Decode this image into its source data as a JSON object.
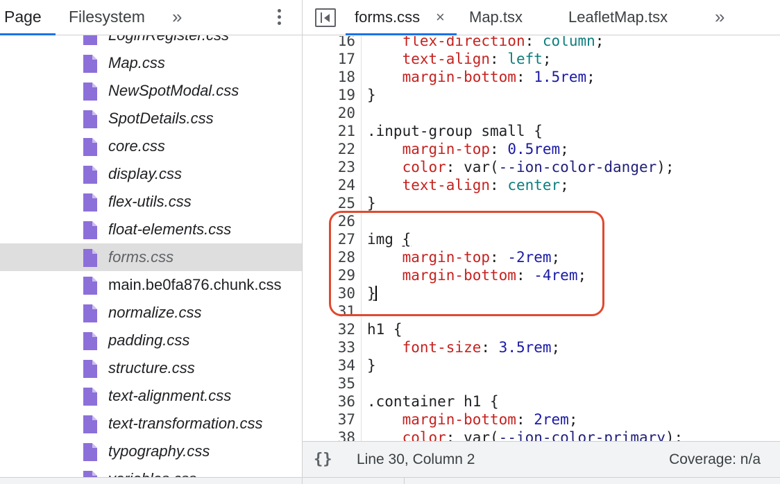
{
  "left_panel": {
    "tabs": [
      {
        "label": "Page"
      },
      {
        "label": "Filesystem"
      }
    ],
    "more_tabs_label": "»",
    "files": [
      {
        "name": "LoginRegister.css",
        "italic": true
      },
      {
        "name": "Map.css",
        "italic": true
      },
      {
        "name": "NewSpotModal.css",
        "italic": true
      },
      {
        "name": "SpotDetails.css",
        "italic": true
      },
      {
        "name": "core.css",
        "italic": true
      },
      {
        "name": "display.css",
        "italic": true
      },
      {
        "name": "flex-utils.css",
        "italic": true
      },
      {
        "name": "float-elements.css",
        "italic": true
      },
      {
        "name": "forms.css",
        "italic": true,
        "selected": true
      },
      {
        "name": "main.be0fa876.chunk.css",
        "italic": false
      },
      {
        "name": "normalize.css",
        "italic": true
      },
      {
        "name": "padding.css",
        "italic": true
      },
      {
        "name": "structure.css",
        "italic": true
      },
      {
        "name": "text-alignment.css",
        "italic": true
      },
      {
        "name": "text-transformation.css",
        "italic": true
      },
      {
        "name": "typography.css",
        "italic": true
      },
      {
        "name": "variables.css",
        "italic": true
      }
    ],
    "file_icon_color": "#8c6fd9"
  },
  "editor": {
    "tabs": [
      {
        "label": "forms.css",
        "close": "×",
        "active": true
      },
      {
        "label": "Map.tsx"
      },
      {
        "label": "LeafletMap.tsx"
      }
    ],
    "more_tabs_label": "»",
    "lines": [
      {
        "n": "16",
        "tokens": [
          {
            "t": "    "
          },
          {
            "t": "flex-direction",
            "c": "prop"
          },
          {
            "t": ": "
          },
          {
            "t": "column",
            "c": "kw"
          },
          {
            "t": ";"
          }
        ]
      },
      {
        "n": "17",
        "tokens": [
          {
            "t": "    "
          },
          {
            "t": "text-align",
            "c": "prop"
          },
          {
            "t": ": "
          },
          {
            "t": "left",
            "c": "kw"
          },
          {
            "t": ";"
          }
        ]
      },
      {
        "n": "18",
        "tokens": [
          {
            "t": "    "
          },
          {
            "t": "margin-bottom",
            "c": "prop"
          },
          {
            "t": ": "
          },
          {
            "t": "1.5rem",
            "c": "num"
          },
          {
            "t": ";"
          }
        ]
      },
      {
        "n": "19",
        "tokens": [
          {
            "t": "}"
          }
        ]
      },
      {
        "n": "20",
        "tokens": []
      },
      {
        "n": "21",
        "tokens": [
          {
            "t": ".input-group small {",
            "c": "sel"
          }
        ]
      },
      {
        "n": "22",
        "tokens": [
          {
            "t": "    "
          },
          {
            "t": "margin-top",
            "c": "prop"
          },
          {
            "t": ": "
          },
          {
            "t": "0.5rem",
            "c": "num"
          },
          {
            "t": ";"
          }
        ]
      },
      {
        "n": "23",
        "tokens": [
          {
            "t": "    "
          },
          {
            "t": "color",
            "c": "prop"
          },
          {
            "t": ": "
          },
          {
            "t": "var(",
            "c": "fn"
          },
          {
            "t": "--ion-color-danger",
            "c": "var"
          },
          {
            "t": ");"
          }
        ]
      },
      {
        "n": "24",
        "tokens": [
          {
            "t": "    "
          },
          {
            "t": "text-align",
            "c": "prop"
          },
          {
            "t": ": "
          },
          {
            "t": "center",
            "c": "kw"
          },
          {
            "t": ";"
          }
        ]
      },
      {
        "n": "25",
        "tokens": [
          {
            "t": "}"
          }
        ]
      },
      {
        "n": "26",
        "tokens": []
      },
      {
        "n": "27",
        "tokens": [
          {
            "t": "img "
          },
          {
            "t": "{",
            "c": "match"
          }
        ]
      },
      {
        "n": "28",
        "tokens": [
          {
            "t": "    "
          },
          {
            "t": "margin-top",
            "c": "prop"
          },
          {
            "t": ": "
          },
          {
            "t": "-2rem",
            "c": "num"
          },
          {
            "t": ";"
          }
        ]
      },
      {
        "n": "29",
        "tokens": [
          {
            "t": "    "
          },
          {
            "t": "margin-bottom",
            "c": "prop"
          },
          {
            "t": ": "
          },
          {
            "t": "-4rem",
            "c": "num"
          },
          {
            "t": ";"
          }
        ]
      },
      {
        "n": "30",
        "tokens": [
          {
            "t": "}",
            "c": "match"
          },
          {
            "caret": true
          }
        ]
      },
      {
        "n": "31",
        "tokens": []
      },
      {
        "n": "32",
        "tokens": [
          {
            "t": "h1 {"
          }
        ]
      },
      {
        "n": "33",
        "tokens": [
          {
            "t": "    "
          },
          {
            "t": "font-size",
            "c": "prop"
          },
          {
            "t": ": "
          },
          {
            "t": "3.5rem",
            "c": "num"
          },
          {
            "t": ";"
          }
        ]
      },
      {
        "n": "34",
        "tokens": [
          {
            "t": "}"
          }
        ]
      },
      {
        "n": "35",
        "tokens": []
      },
      {
        "n": "36",
        "tokens": [
          {
            "t": ".container h1 {"
          }
        ]
      },
      {
        "n": "37",
        "tokens": [
          {
            "t": "    "
          },
          {
            "t": "margin-bottom",
            "c": "prop"
          },
          {
            "t": ": "
          },
          {
            "t": "2rem",
            "c": "num"
          },
          {
            "t": ";"
          }
        ]
      },
      {
        "n": "38",
        "tokens": [
          {
            "t": "    "
          },
          {
            "t": "color",
            "c": "prop"
          },
          {
            "t": ": "
          },
          {
            "t": "var(",
            "c": "fn"
          },
          {
            "t": "--ion-color-primary",
            "c": "var"
          },
          {
            "t": ");"
          }
        ]
      }
    ],
    "highlight_color": "#e0492e"
  },
  "status_bar": {
    "pretty_print_label": "{}",
    "cursor_position": "Line 30, Column 2",
    "coverage": "Coverage: n/a"
  }
}
